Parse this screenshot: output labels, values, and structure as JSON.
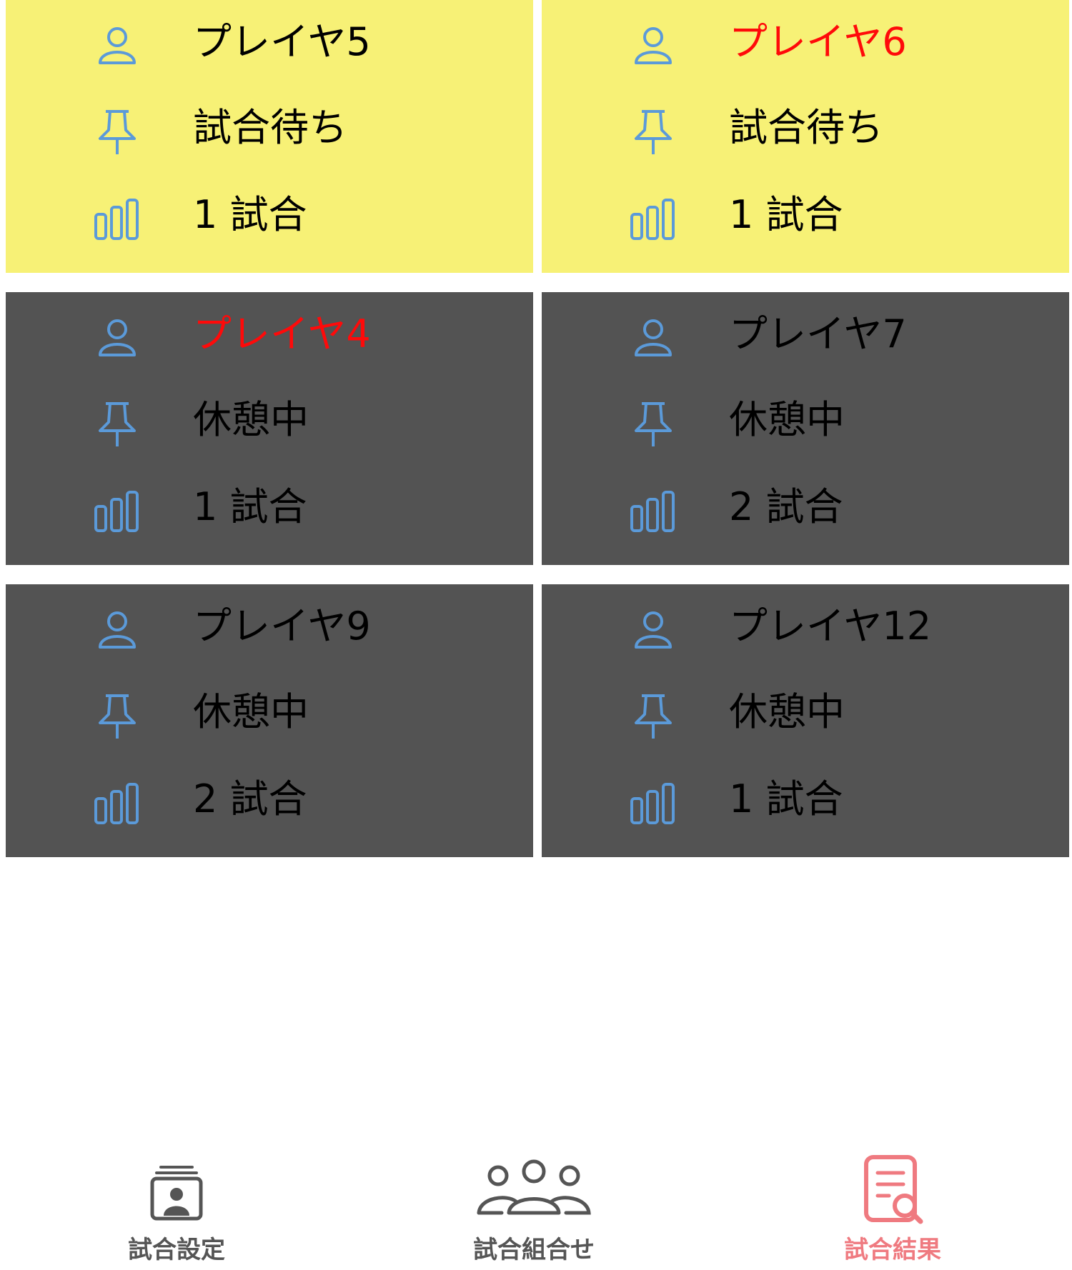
{
  "players": [
    {
      "name": "プレイヤ5",
      "status": "試合待ち",
      "matches": "1 試合",
      "state": "waiting",
      "highlight": false
    },
    {
      "name": "プレイヤ6",
      "status": "試合待ち",
      "matches": "1 試合",
      "state": "waiting",
      "highlight": true
    },
    {
      "name": "プレイヤ4",
      "status": "休憩中",
      "matches": "1 試合",
      "state": "resting",
      "highlight": true
    },
    {
      "name": "プレイヤ7",
      "status": "休憩中",
      "matches": "2 試合",
      "state": "resting",
      "highlight": false
    },
    {
      "name": "プレイヤ9",
      "status": "休憩中",
      "matches": "2 試合",
      "state": "resting",
      "highlight": false
    },
    {
      "name": "プレイヤ12",
      "status": "休憩中",
      "matches": "1 試合",
      "state": "resting",
      "highlight": false
    }
  ],
  "tabs": [
    {
      "label": "試合設定",
      "icon": "match-settings-icon",
      "active": false
    },
    {
      "label": "試合組合せ",
      "icon": "people-group-icon",
      "active": false
    },
    {
      "label": "試合結果",
      "icon": "document-search-icon",
      "active": true
    }
  ],
  "colors": {
    "waiting_bg": "#f7f176",
    "resting_bg": "#535353",
    "icon_blue": "#5b9ad9",
    "highlight_red": "#ff0a0a",
    "tab_inactive": "#555555",
    "tab_active": "#ef7a80"
  }
}
